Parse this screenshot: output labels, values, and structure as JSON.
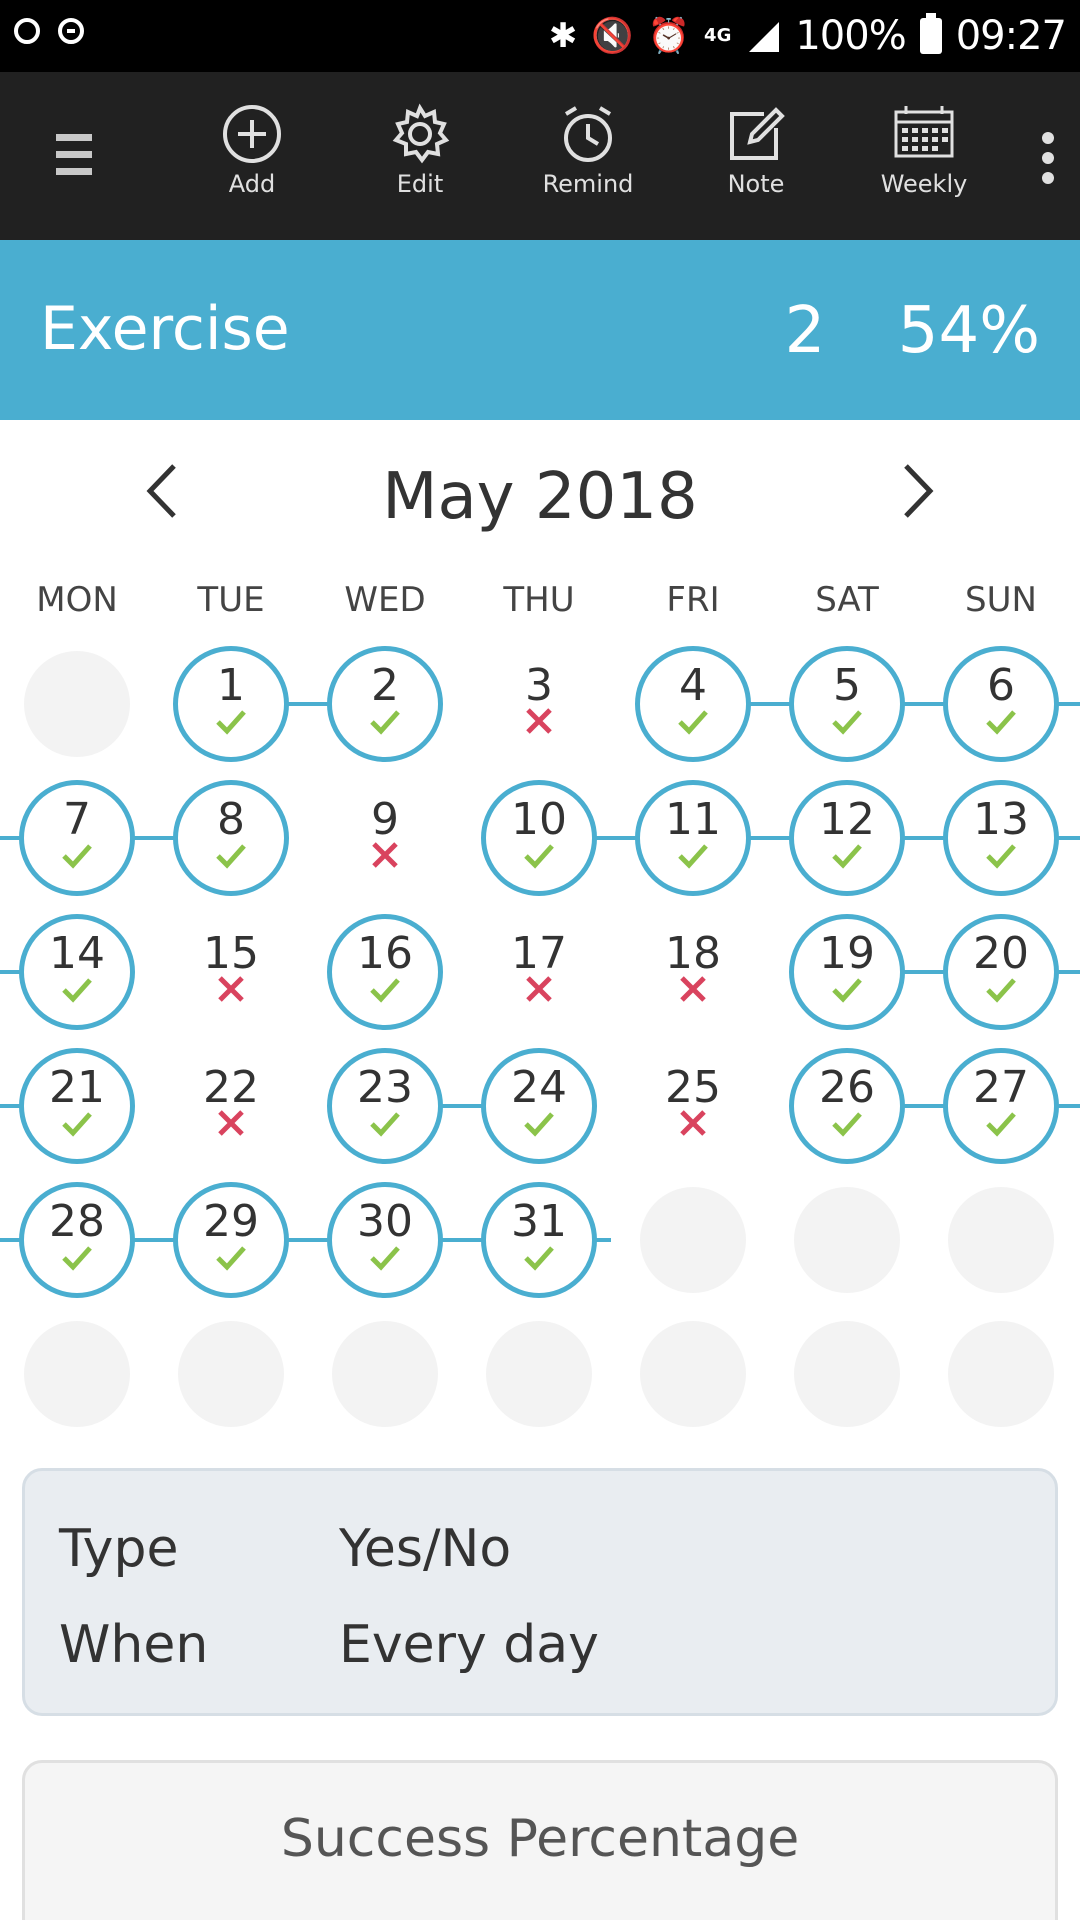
{
  "status_bar": {
    "battery": "100%",
    "time": "09:27",
    "network": "4G"
  },
  "toolbar": {
    "add_label": "Add",
    "edit_label": "Edit",
    "remind_label": "Remind",
    "note_label": "Note",
    "weekly_label": "Weekly"
  },
  "habit": {
    "name": "Exercise",
    "streak": "2",
    "success_percent": "54%"
  },
  "calendar": {
    "month_title": "May 2018",
    "weekdays": [
      "MON",
      "TUE",
      "WED",
      "THU",
      "FRI",
      "SAT",
      "SUN"
    ],
    "first_weekday_index": 1,
    "days_in_month": 31,
    "done_days": [
      1,
      2,
      4,
      5,
      6,
      7,
      8,
      10,
      11,
      12,
      13,
      14,
      16,
      19,
      20,
      21,
      23,
      24,
      26,
      27,
      28,
      29,
      30,
      31
    ],
    "missed_days": [
      3,
      9,
      15,
      17,
      18,
      22,
      25
    ]
  },
  "info": {
    "type_label": "Type",
    "type_value": "Yes/No",
    "when_label": "When",
    "when_value": "Every day"
  },
  "success": {
    "title": "Success Percentage"
  },
  "colors": {
    "accent": "#4aaed0",
    "check": "#8bc34a",
    "cross": "#d9435e",
    "toolbar": "#212121"
  }
}
